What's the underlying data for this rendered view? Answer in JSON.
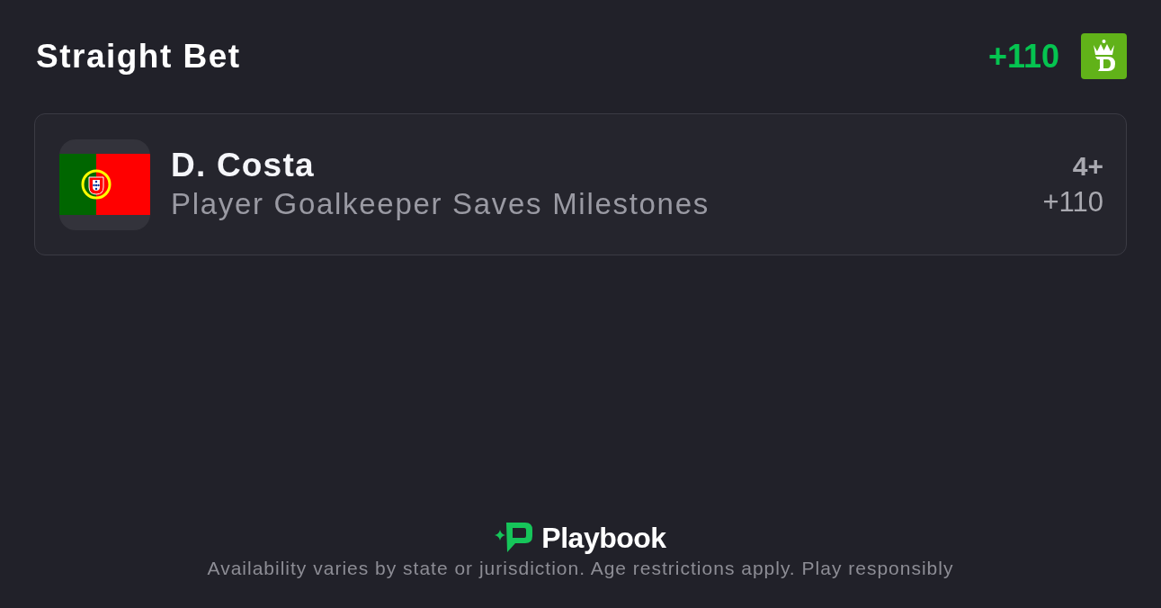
{
  "header": {
    "title": "Straight Bet",
    "odds": "+110"
  },
  "bets": [
    {
      "player": "D. Costa",
      "market": "Player Goalkeeper Saves Milestones",
      "line": "4+",
      "odds": "+110"
    }
  ],
  "footer": {
    "brand": "Playbook",
    "disclaimer": "Availability varies by state or jurisdiction. Age restrictions apply. Play responsibly"
  }
}
